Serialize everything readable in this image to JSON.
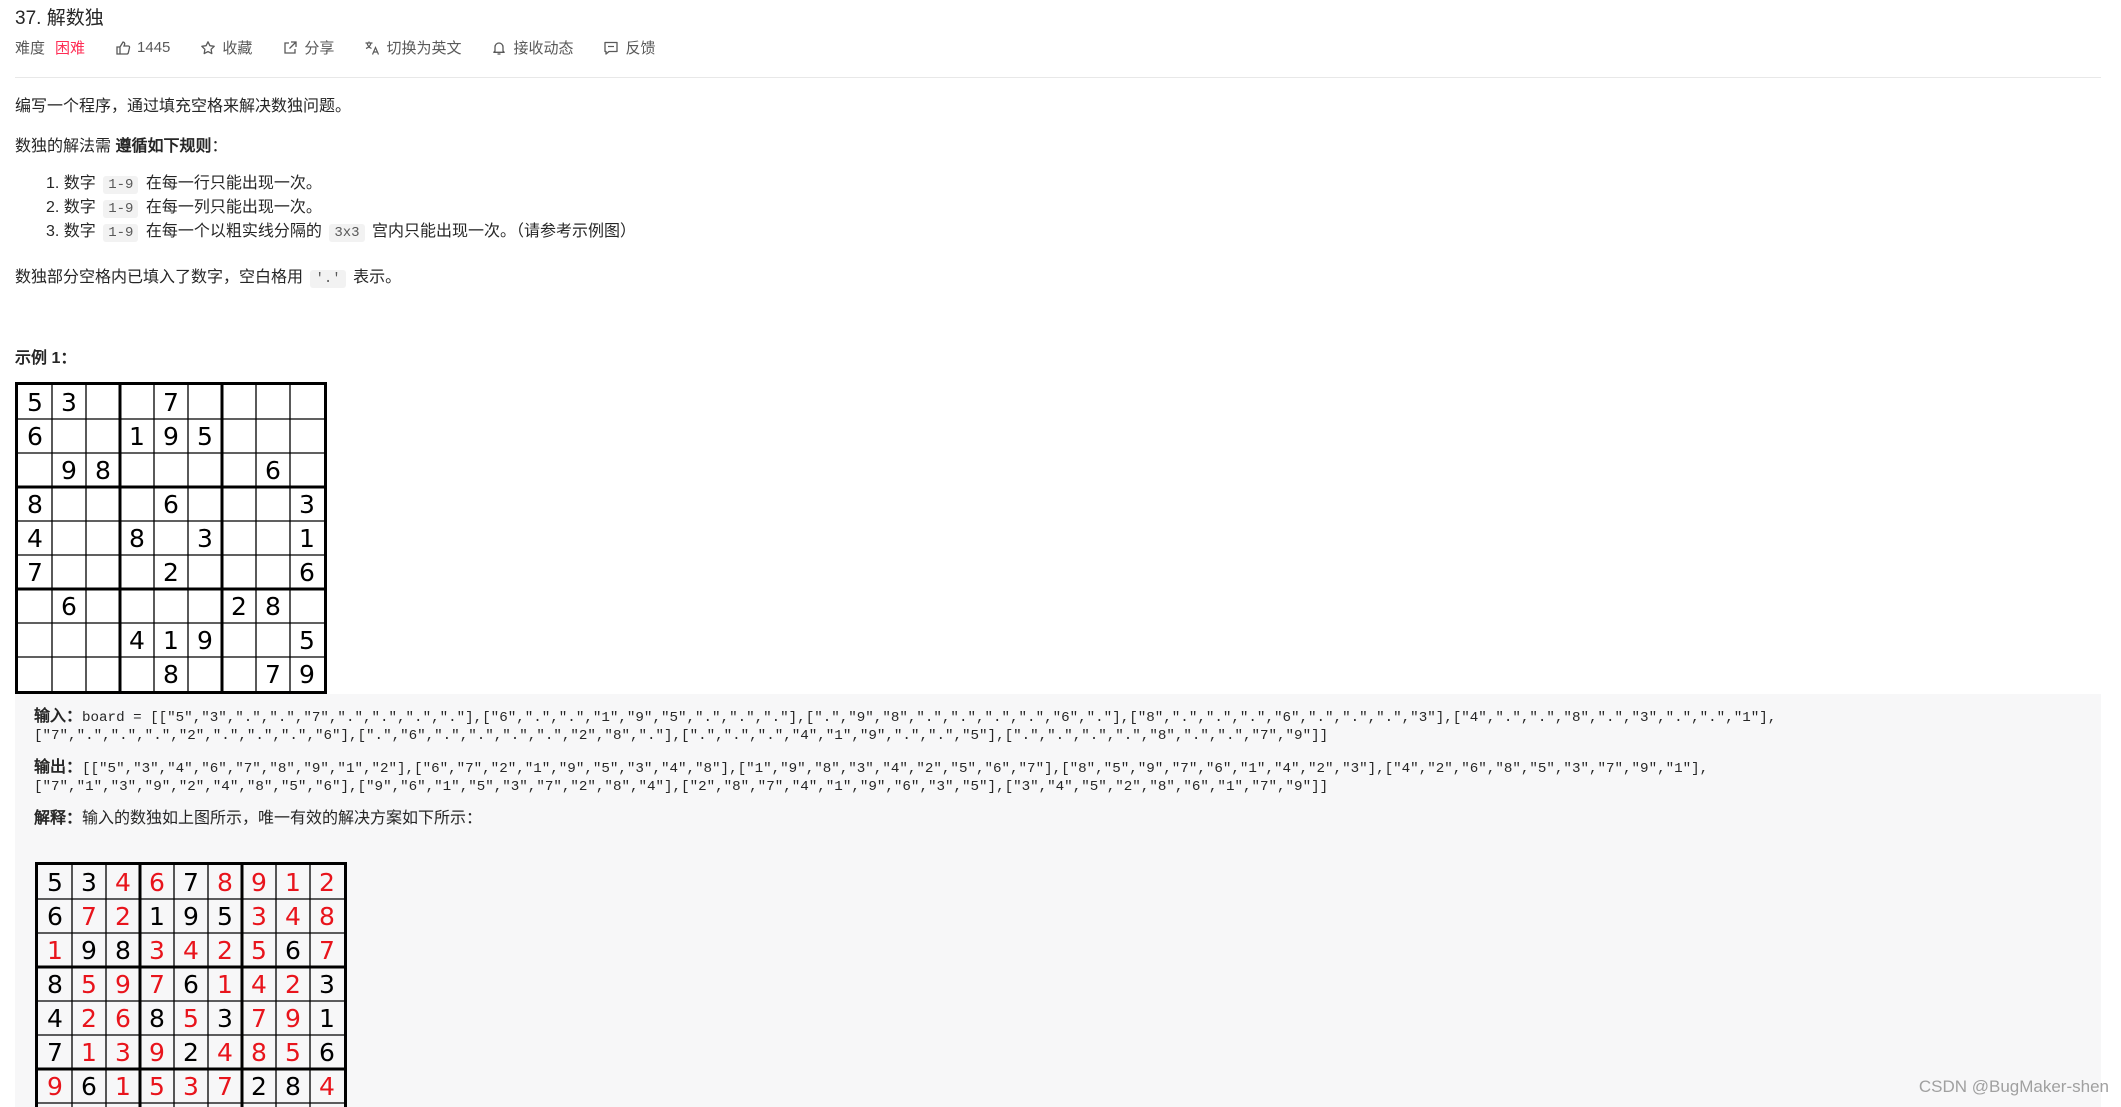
{
  "problem": {
    "title": "37. 解数独",
    "difficulty_label": "难度",
    "difficulty_value": "困难",
    "likes": "1445",
    "favorite_label": "收藏",
    "share_label": "分享",
    "switch_lang_label": "切换为英文",
    "subscribe_label": "接收动态",
    "feedback_label": "反馈"
  },
  "description": {
    "intro": "编写一个程序，通过填充空格来解决数独问题。",
    "rules_lead_prefix": "数独的解法需 ",
    "rules_lead_bold": "遵循如下规则",
    "rules_lead_suffix": "：",
    "rules": [
      {
        "num": "1.",
        "prefix": "数字 ",
        "code": "1-9",
        "suffix": " 在每一行只能出现一次。"
      },
      {
        "num": "2.",
        "prefix": "数字 ",
        "code": "1-9",
        "suffix": " 在每一列只能出现一次。"
      },
      {
        "num": "3.",
        "prefix": "数字 ",
        "code": "1-9",
        "mid": " 在每一个以粗实线分隔的 ",
        "code2": "3x3",
        "suffix": " 宫内只能出现一次。（请参考示例图）"
      }
    ],
    "blank_note_prefix": "数独部分空格内已填入了数字，空白格用 ",
    "blank_note_code": "'.'",
    "blank_note_suffix": " 表示。"
  },
  "example": {
    "title": "示例 1：",
    "input_label": "输入：",
    "input_line1": "board = [[\"5\",\"3\",\".\",\".\",\"7\",\".\",\".\",\".\",\".\"],[\"6\",\".\",\".\",\"1\",\"9\",\"5\",\".\",\".\",\".\"],[\".\",\"9\",\"8\",\".\",\".\",\".\",\".\",\"6\",\".\"],[\"8\",\".\",\".\",\".\",\"6\",\".\",\".\",\".\",\"3\"],[\"4\",\".\",\".\",\"8\",\".\",\"3\",\".\",\".\",\"1\"],",
    "input_line2": "[\"7\",\".\",\".\",\".\",\"2\",\".\",\".\",\".\",\"6\"],[\".\",\"6\",\".\",\".\",\".\",\".\",\"2\",\"8\",\".\"],[\".\",\".\",\".\",\"4\",\"1\",\"9\",\".\",\".\",\"5\"],[\".\",\".\",\".\",\".\",\"8\",\".\",\".\",\"7\",\"9\"]]",
    "output_label": "输出：",
    "output_line1": "[[\"5\",\"3\",\"4\",\"6\",\"7\",\"8\",\"9\",\"1\",\"2\"],[\"6\",\"7\",\"2\",\"1\",\"9\",\"5\",\"3\",\"4\",\"8\"],[\"1\",\"9\",\"8\",\"3\",\"4\",\"2\",\"5\",\"6\",\"7\"],[\"8\",\"5\",\"9\",\"7\",\"6\",\"1\",\"4\",\"2\",\"3\"],[\"4\",\"2\",\"6\",\"8\",\"5\",\"3\",\"7\",\"9\",\"1\"],",
    "output_line2": "[\"7\",\"1\",\"3\",\"9\",\"2\",\"4\",\"8\",\"5\",\"6\"],[\"9\",\"6\",\"1\",\"5\",\"3\",\"7\",\"2\",\"8\",\"4\"],[\"2\",\"8\",\"7\",\"4\",\"1\",\"9\",\"6\",\"3\",\"5\"],[\"3\",\"4\",\"5\",\"2\",\"8\",\"6\",\"1\",\"7\",\"9\"]]",
    "explain_label": "解释：",
    "explain_text": "输入的数独如上图所示，唯一有效的解决方案如下所示："
  },
  "input_board": [
    [
      "5",
      "3",
      "",
      "",
      "7",
      "",
      "",
      "",
      ""
    ],
    [
      "6",
      "",
      "",
      "1",
      "9",
      "5",
      "",
      "",
      ""
    ],
    [
      "",
      "9",
      "8",
      "",
      "",
      "",
      "",
      "6",
      ""
    ],
    [
      "8",
      "",
      "",
      "",
      "6",
      "",
      "",
      "",
      "3"
    ],
    [
      "4",
      "",
      "",
      "8",
      "",
      "3",
      "",
      "",
      "1"
    ],
    [
      "7",
      "",
      "",
      "",
      "2",
      "",
      "",
      "",
      "6"
    ],
    [
      "",
      "6",
      "",
      "",
      "",
      "",
      "2",
      "8",
      ""
    ],
    [
      "",
      "",
      "",
      "4",
      "1",
      "9",
      "",
      "",
      "5"
    ],
    [
      "",
      "",
      "",
      "",
      "8",
      "",
      "",
      "7",
      "9"
    ]
  ],
  "solution_board_visible": [
    [
      "5",
      "3",
      "4",
      "6",
      "7",
      "8",
      "9",
      "1",
      "2"
    ],
    [
      "6",
      "7",
      "2",
      "1",
      "9",
      "5",
      "3",
      "4",
      "8"
    ],
    [
      "1",
      "9",
      "8",
      "3",
      "4",
      "2",
      "5",
      "6",
      "7"
    ],
    [
      "8",
      "5",
      "9",
      "7",
      "6",
      "1",
      "4",
      "2",
      "3"
    ],
    [
      "4",
      "2",
      "6",
      "8",
      "5",
      "3",
      "7",
      "9",
      "1"
    ],
    [
      "7",
      "1",
      "3",
      "9",
      "2",
      "4",
      "8",
      "5",
      "6"
    ],
    [
      "9",
      "6",
      "1",
      "5",
      "3",
      "7",
      "2",
      "8",
      "4"
    ]
  ],
  "colors": {
    "given": "#000000",
    "filled": "#e8141c",
    "difficulty_hard": "#ff2d55"
  },
  "watermark": "CSDN @BugMaker-shen"
}
